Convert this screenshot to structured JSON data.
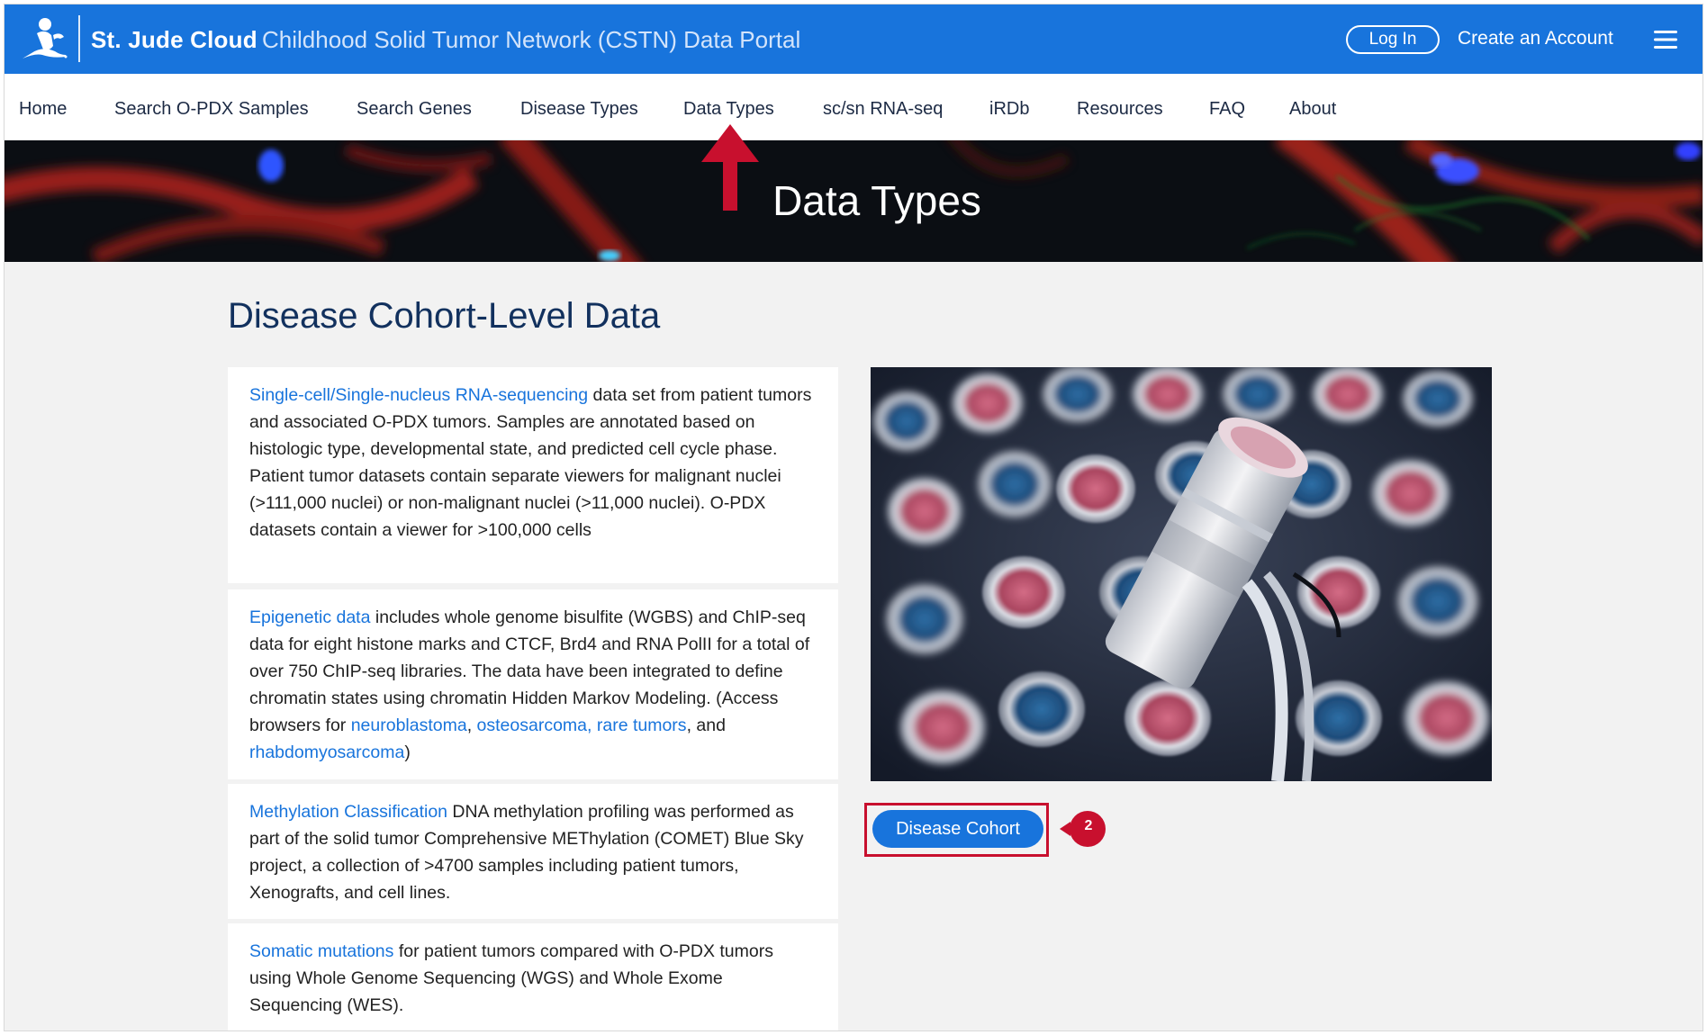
{
  "header": {
    "brand_name": "St. Jude Cloud",
    "portal_name": "Childhood Solid Tumor Network (CSTN) Data Portal",
    "login_label": "Log In",
    "create_account_label": "Create an Account",
    "menu_icon": "hamburger-menu-icon",
    "logo_icon": "st-jude-child-logo-icon"
  },
  "nav": {
    "items": [
      {
        "label": "Home"
      },
      {
        "label": "Search O-PDX Samples"
      },
      {
        "label": "Search Genes"
      },
      {
        "label": "Disease Types"
      },
      {
        "label": "Data Types"
      },
      {
        "label": "sc/sn RNA-seq"
      },
      {
        "label": "iRDb"
      },
      {
        "label": "Resources"
      },
      {
        "label": "FAQ"
      },
      {
        "label": "About"
      }
    ]
  },
  "banner": {
    "title": "Data Types"
  },
  "main": {
    "section_title": "Disease Cohort-Level Data",
    "cards": [
      {
        "link": "Single-cell/Single-nucleus RNA-sequencing",
        "text": " data set from patient tumors and associated O-PDX tumors. Samples are annotated based on histologic type, developmental state, and predicted cell cycle phase. Patient tumor datasets contain separate viewers for malignant nuclei (>111,000 nuclei) or non-malignant nuclei (>11,000 nuclei). O-PDX datasets contain a viewer for >100,000 cells"
      },
      {
        "link": "Epigenetic data",
        "text": " includes whole genome bisulfite (WGBS) and ChIP-seq data for eight histone marks and CTCF, Brd4 and RNA PolII for a total of over 750 ChIP-seq libraries. The data have been integrated to define chromatin states using chromatin Hidden Markov Modeling. (Access browsers for ",
        "link_neuroblastoma": "neuroblastoma",
        "sep1": ", ",
        "link_osteo_rare": "osteosarcoma, rare tumors",
        "sep2": ", and ",
        "link_rhabdo": "rhabdomyosarcoma",
        "close": ")"
      },
      {
        "link": "Methylation Classification",
        "text": " DNA methylation profiling was performed as part of the solid tumor Comprehensive METhylation (COMET) Blue Sky project, a collection of >4700 samples including patient tumors, Xenografts, and cell lines."
      },
      {
        "link": "Somatic mutations",
        "text": " for patient tumors compared with O-PDX tumors using Whole Genome Sequencing (WGS) and Whole Exome Sequencing (WES)."
      }
    ],
    "cohort_button_label": "Disease Cohort",
    "step_badge": "2"
  },
  "colors": {
    "brand_blue": "#1874dc",
    "annotation_red": "#c8102e",
    "title_navy": "#12315e"
  }
}
